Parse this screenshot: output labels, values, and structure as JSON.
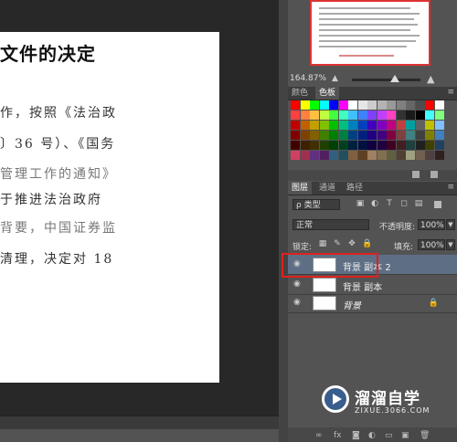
{
  "document": {
    "title": "文件的决定",
    "lines": [
      {
        "text": "作，按照《法治政",
        "faint": true
      },
      {
        "text": "〕36 号）、《国务",
        "faint": false
      },
      {
        "text": "管理工作的通知》",
        "faint": true
      },
      {
        "text": "于推进法治政府",
        "faint": false
      },
      {
        "text": "背要，中国证券监",
        "faint": true
      },
      {
        "text": "清理，决定对 18",
        "faint": false
      }
    ]
  },
  "navigator": {
    "zoom": "164.87%"
  },
  "color_panel": {
    "tabs": [
      "颜色",
      "色板"
    ],
    "active_tab": "色板",
    "swatches": [
      [
        "#ff0000",
        "#ffff00",
        "#00ff00",
        "#00ffff",
        "#0000ff",
        "#ff00ff",
        "#ffffff",
        "#e6e6e6",
        "#cccccc",
        "#b3b3b3",
        "#999999",
        "#808080",
        "#666666",
        "#4d4d4d",
        "#ff0000",
        "#ffffff"
      ],
      [
        "#ff4040",
        "#ff8040",
        "#ffc040",
        "#c0ff40",
        "#40ff40",
        "#40ffc0",
        "#40c0ff",
        "#4080ff",
        "#8040ff",
        "#c040ff",
        "#ff40c0",
        "#333333",
        "#1a1a1a",
        "#000000",
        "#40ffff",
        "#80ff80"
      ],
      [
        "#c00000",
        "#c06000",
        "#c0a000",
        "#80c000",
        "#00c000",
        "#00c080",
        "#0080c0",
        "#0040c0",
        "#4000c0",
        "#8000c0",
        "#c00080",
        "#c04040",
        "#00a0a0",
        "#606060",
        "#c0c000",
        "#80c0ff"
      ],
      [
        "#800000",
        "#804000",
        "#806000",
        "#408000",
        "#008000",
        "#008040",
        "#004080",
        "#002080",
        "#200080",
        "#400080",
        "#800040",
        "#804040",
        "#408080",
        "#404040",
        "#808000",
        "#4080c0"
      ],
      [
        "#400000",
        "#402000",
        "#403000",
        "#204000",
        "#004000",
        "#004020",
        "#002040",
        "#001040",
        "#100040",
        "#200040",
        "#400020",
        "#402020",
        "#204040",
        "#202020",
        "#404000",
        "#204060"
      ],
      [
        "#d04060",
        "#a03050",
        "#603080",
        "#502060",
        "#306080",
        "#205060",
        "#806040",
        "#604020",
        "#a08060",
        "#807050",
        "#606040",
        "#504030",
        "#a0a080",
        "#706050",
        "#504040",
        "#302020"
      ]
    ]
  },
  "layers_panel": {
    "tabs": [
      "图层",
      "通道",
      "路径"
    ],
    "active_tab": "图层",
    "filter_label": "ρ 类型",
    "blend_mode": "正常",
    "opacity_label": "不透明度:",
    "opacity_value": "100%",
    "lock_label": "锁定:",
    "fill_label": "填充:",
    "fill_value": "100%",
    "layers": [
      {
        "name": "背景 副本 2",
        "selected": true,
        "italic": false,
        "locked": false
      },
      {
        "name": "背景 副本",
        "selected": false,
        "italic": false,
        "locked": false
      },
      {
        "name": "背景",
        "selected": false,
        "italic": true,
        "locked": true
      }
    ]
  },
  "watermark": {
    "title": "溜溜自学",
    "subtitle": "ZIXUE.3066.COM"
  }
}
